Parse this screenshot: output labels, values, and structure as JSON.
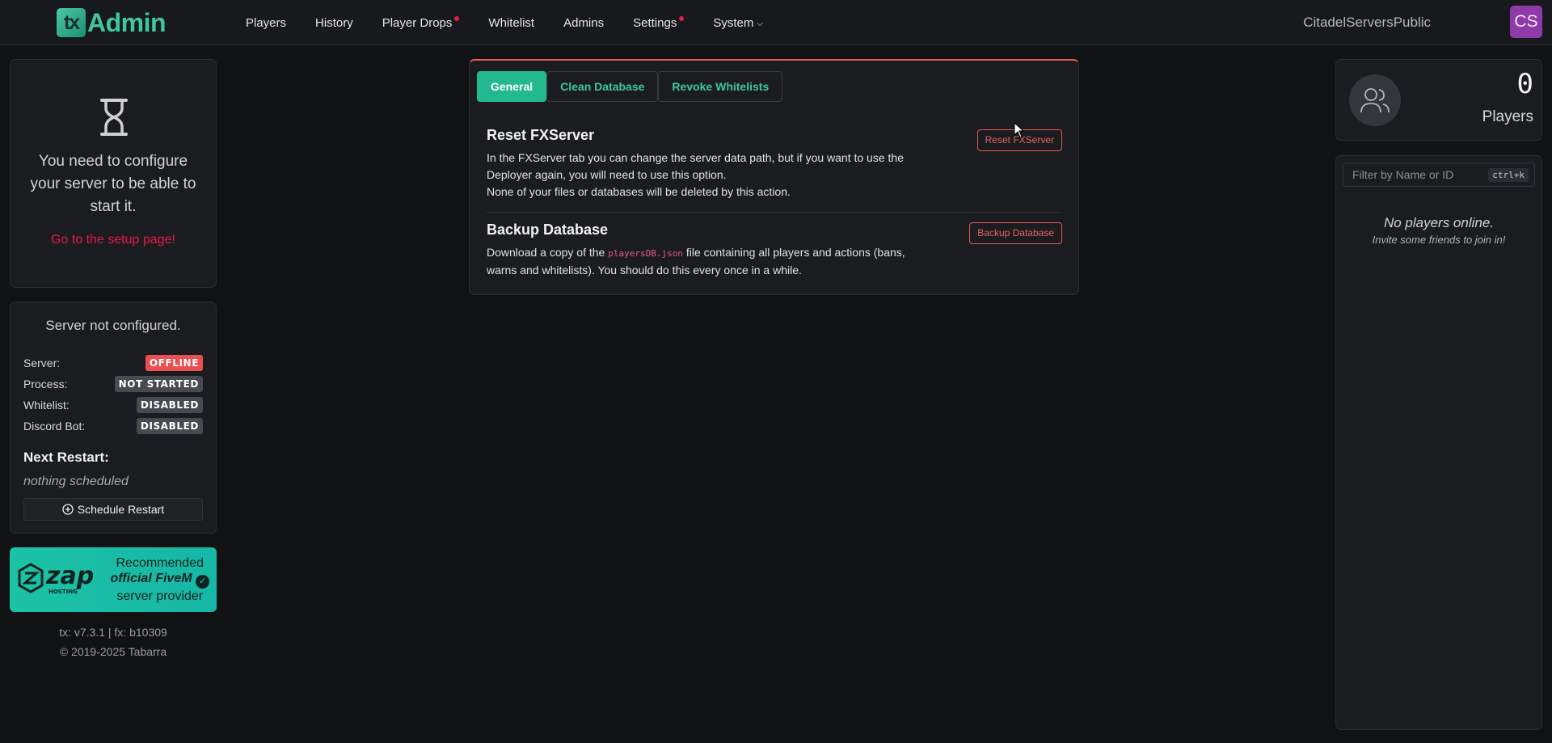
{
  "brand": {
    "logo_mark": "tx",
    "logo_text": "Admin"
  },
  "nav": {
    "items": [
      {
        "label": "Players",
        "dot": false
      },
      {
        "label": "History",
        "dot": false
      },
      {
        "label": "Player Drops",
        "dot": true
      },
      {
        "label": "Whitelist",
        "dot": false
      },
      {
        "label": "Admins",
        "dot": false
      },
      {
        "label": "Settings",
        "dot": true
      },
      {
        "label": "System",
        "dot": false,
        "dropdown": true
      }
    ]
  },
  "user": {
    "name": "CitadelServersPublic",
    "initials": "CS"
  },
  "setup": {
    "message": "You need to configure your server to be able to start it.",
    "link": "Go to the setup page!"
  },
  "status": {
    "title": "Server not configured.",
    "rows": [
      {
        "label": "Server:",
        "value": "OFFLINE"
      },
      {
        "label": "Process:",
        "value": "NOT STARTED"
      },
      {
        "label": "Whitelist:",
        "value": "DISABLED"
      },
      {
        "label": "Discord Bot:",
        "value": "DISABLED"
      }
    ],
    "next_restart_label": "Next Restart:",
    "next_restart_value": "nothing scheduled",
    "schedule_button": "Schedule Restart"
  },
  "zap": {
    "line1": "Recommended",
    "line2": "official FiveM",
    "line3": "server provider"
  },
  "footer": {
    "version": "tx: v7.3.1 | fx: b10309",
    "copyright": "© 2019-2025 Tabarra"
  },
  "settings": {
    "tabs": [
      {
        "label": "General",
        "active": true
      },
      {
        "label": "Clean Database",
        "active": false
      },
      {
        "label": "Revoke Whitelists",
        "active": false
      }
    ],
    "reset": {
      "title": "Reset FXServer",
      "desc_line1": "In the FXServer tab you can change the server data path, but if you want to use the Deployer again, you will need to use this option.",
      "desc_line2": "None of your files or databases will be deleted by this action.",
      "button": "Reset FXServer"
    },
    "backup": {
      "title": "Backup Database",
      "desc_pre": "Download a copy of the ",
      "desc_code": "playersDB.json",
      "desc_post": " file containing all players and actions (bans, warns and whitelists). You should do this every once in a while.",
      "button": "Backup Database"
    }
  },
  "players": {
    "count": "0",
    "label": "Players",
    "filter_placeholder": "Filter by Name or ID",
    "shortcut": "ctrl+k",
    "empty_title": "No players online.",
    "empty_sub": "Invite some friends to join in!"
  },
  "colors": {
    "accent": "#23b98f",
    "danger": "#e85a57",
    "notification_dot": "#e8194a"
  }
}
